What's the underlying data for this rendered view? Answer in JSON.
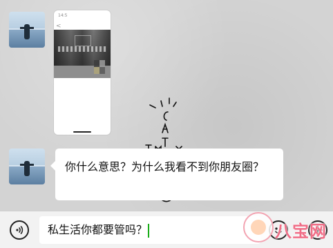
{
  "chat": {
    "image_message": {
      "status_bar_time": "14:5",
      "back_glyph": "<"
    },
    "text_message": {
      "text": "你什么意思？为什么我看不到你朋友圈？"
    },
    "doodle_icon": "handwritten-doodle"
  },
  "input_bar": {
    "value": "私生活你都要管吗？",
    "voice_icon": "voice-icon",
    "emoji_icon": "emoji-icon",
    "plus_icon": "plus-icon"
  },
  "watermark": {
    "text": "八宝网"
  },
  "colors": {
    "bubble": "#ffffff",
    "caret": "#1aad19",
    "watermark": "#f06d86"
  }
}
